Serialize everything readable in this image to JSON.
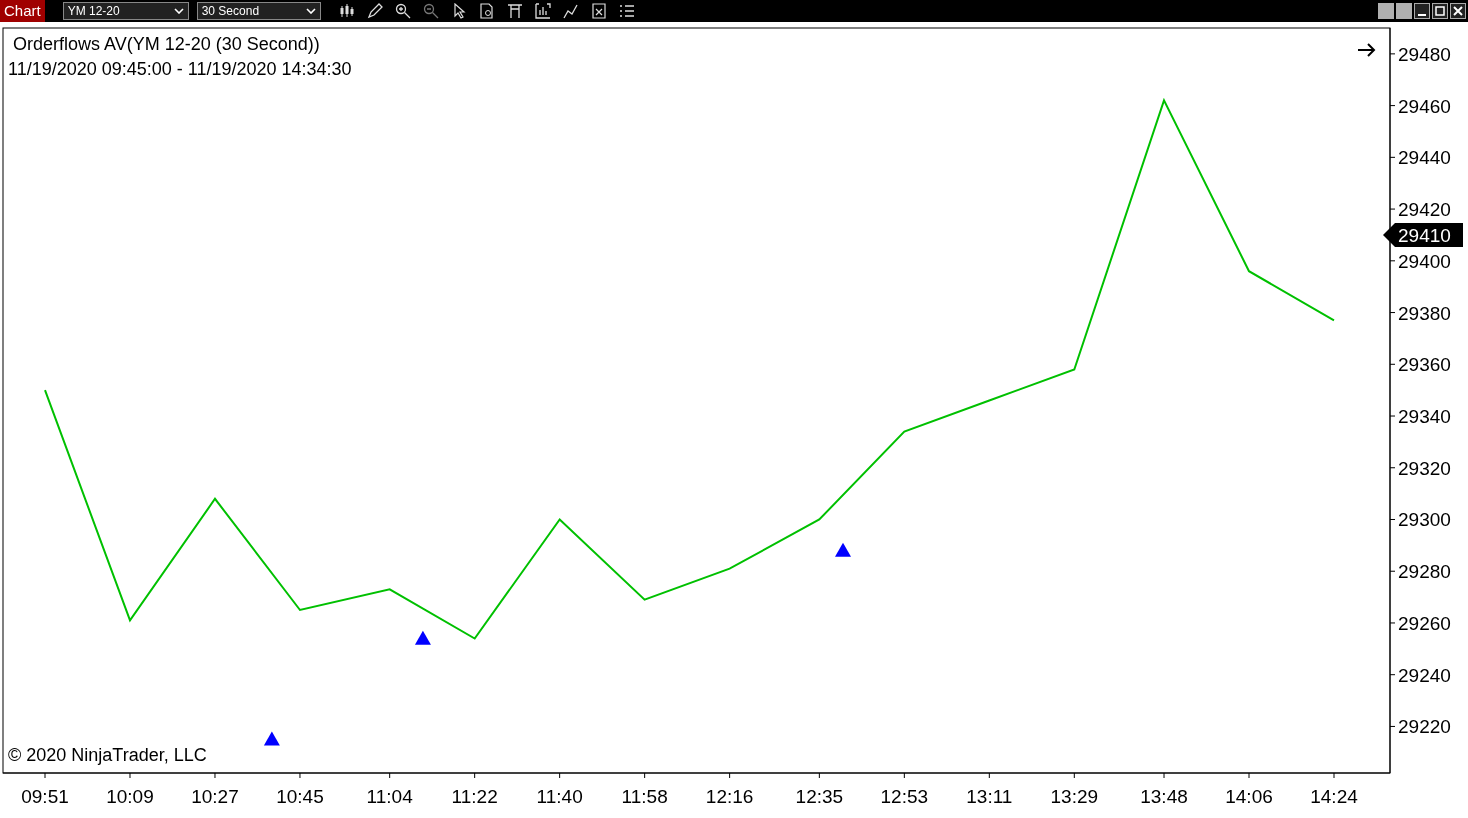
{
  "toolbar": {
    "title": "Chart",
    "instrument": {
      "value": "YM 12-20"
    },
    "interval": {
      "value": "30 Second"
    }
  },
  "chart": {
    "title": "Orderflows AV(YM 12-20 (30 Second))",
    "range": "11/19/2020 09:45:00 - 11/19/2020 14:34:30",
    "copyright": "© 2020 NinjaTrader, LLC",
    "last_price": "29410",
    "chart_data": {
      "type": "line",
      "categories": [
        "09:51",
        "10:09",
        "10:27",
        "10:45",
        "11:04",
        "11:22",
        "11:40",
        "11:58",
        "12:16",
        "12:35",
        "12:53",
        "13:11",
        "13:29",
        "13:48",
        "14:06",
        "14:24"
      ],
      "series": [
        {
          "color": "#00c000",
          "values": [
            29350,
            29261,
            29308,
            29265,
            29273,
            29254,
            29300,
            29269,
            29281,
            29300,
            29334,
            29346,
            29358,
            29462,
            29396,
            29377
          ]
        }
      ],
      "ylim": [
        29202,
        29490
      ],
      "yticks": [
        29220,
        29240,
        29260,
        29280,
        29300,
        29320,
        29340,
        29360,
        29380,
        29400,
        29420,
        29440,
        29460,
        29480
      ]
    }
  }
}
